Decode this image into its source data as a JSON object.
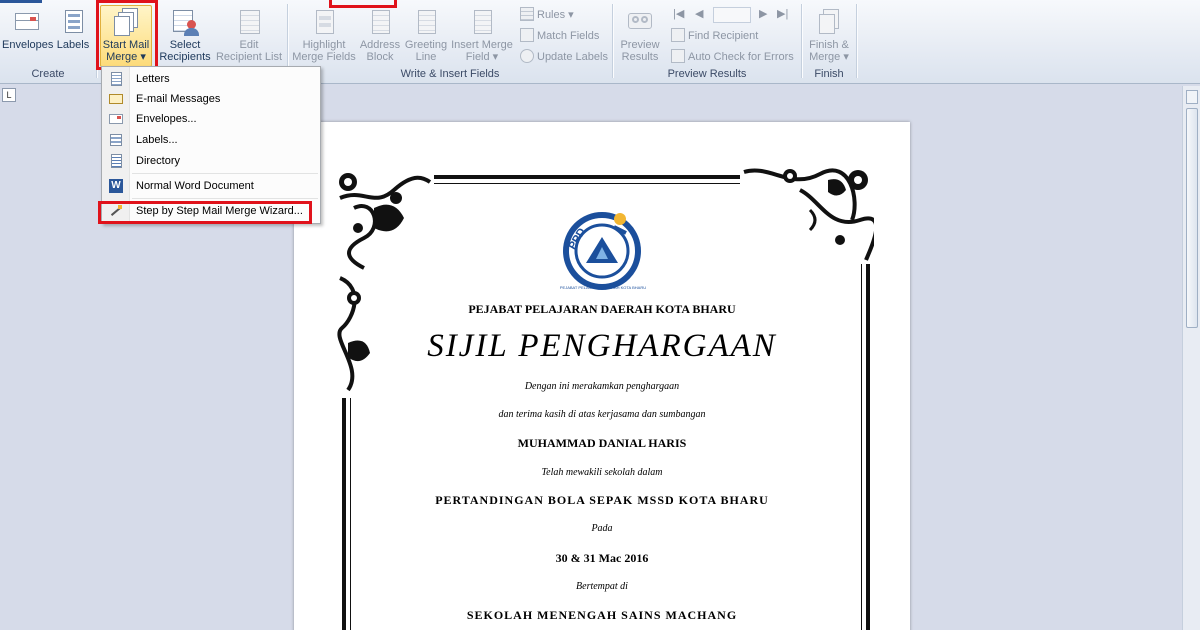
{
  "ribbon": {
    "create": {
      "group_label": "Create",
      "envelopes": "Envelopes",
      "labels": "Labels"
    },
    "start": {
      "start_mail_merge": [
        "Start Mail",
        "Merge ▾"
      ],
      "select_recipients": [
        "Select",
        "Recipients ▾"
      ],
      "edit_recipient_list": [
        "Edit",
        "Recipient List"
      ]
    },
    "write": {
      "group_label": "Write & Insert Fields",
      "highlight": [
        "Highlight",
        "Merge Fields"
      ],
      "address_block": [
        "Address",
        "Block"
      ],
      "greeting_line": [
        "Greeting",
        "Line"
      ],
      "insert_merge_field": [
        "Insert Merge",
        "Field ▾"
      ],
      "rules": "Rules ▾",
      "match_fields": "Match Fields",
      "update_labels": "Update Labels"
    },
    "preview": {
      "group_label": "Preview Results",
      "preview_results": [
        "Preview",
        "Results"
      ],
      "find_recipient": "Find Recipient",
      "auto_check": "Auto Check for Errors"
    },
    "finish": {
      "group_label": "Finish",
      "finish_merge": [
        "Finish &",
        "Merge ▾"
      ]
    }
  },
  "menu": {
    "items": [
      {
        "label": "Letters"
      },
      {
        "label": "E-mail Messages"
      },
      {
        "label": "Envelopes..."
      },
      {
        "label": "Labels..."
      },
      {
        "label": "Directory"
      },
      {
        "label": "Normal Word Document"
      },
      {
        "label": "Step by Step Mail Merge Wizard..."
      }
    ]
  },
  "ruler": {
    "tab_symbol": "L"
  },
  "certificate": {
    "logo_text": "PPD",
    "logo_ring_text": "PEJABAT PELAJARAN DAERAH KOTA BHARU",
    "office": "PEJABAT PELAJARAN DAERAH KOTA BHARU",
    "title": "SIJIL PENGHARGAAN",
    "line1": "Dengan ini merakamkan penghargaan",
    "line2": "dan terima kasih di atas kerjasama dan sumbangan",
    "recipient": "MUHAMMAD DANIAL  HARIS",
    "line3": "Telah mewakili sekolah dalam",
    "event": "PERTANDINGAN BOLA SEPAK MSSD KOTA BHARU",
    "line4": "Pada",
    "date": "30 & 31 Mac 2016",
    "line5": "Bertempat di",
    "venue": "SEKOLAH MENENGAH SAINS MACHANG"
  },
  "colors": {
    "highlight_box": "#e0121b",
    "ribbon_text": "#1e395b",
    "active_button": "#fde7a0"
  }
}
